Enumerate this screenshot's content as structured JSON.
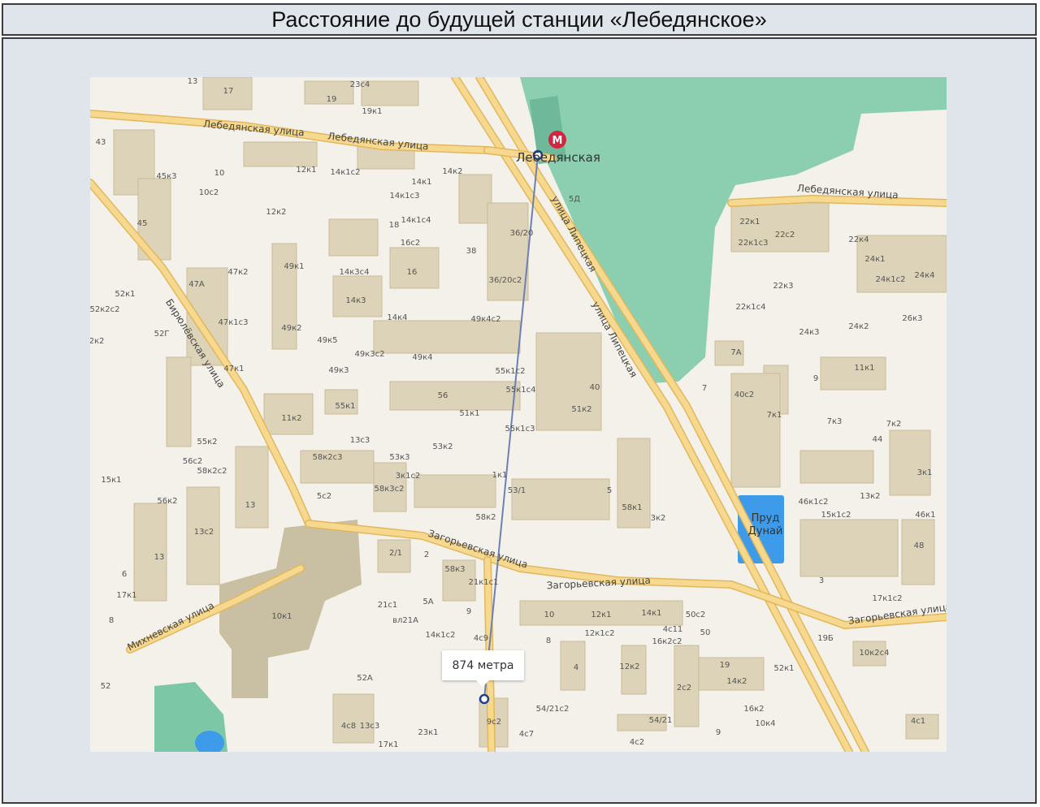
{
  "title": "Расстояние до будущей станции «Лебедянское»",
  "map": {
    "distance_label": "874 метра",
    "metro_station": "Лебедянская",
    "metro_icon": "metro-m-icon",
    "colors": {
      "water": "#8ccfb0",
      "pond": "#3d9be9",
      "road": "#f6d98f",
      "route": "#6d80b3",
      "metro": "#d2253f",
      "building": "#ddd3b8"
    },
    "streets": {
      "lebedyanskaya_1": "Лебедянская улица",
      "lebedyanskaya_2": "Лебедянская улица",
      "lebedyanskaya_3": "Лебедянская улица",
      "lipetskaya_1": "улица Липецкая",
      "lipetskaya_2": "улица Липецкая",
      "birulevskaya": "Бирюлёвская улица",
      "zagoryevskaya_1": "Загорьевская улица",
      "zagoryevskaya_2": "Загорьевская улица",
      "zagoryevskaya_3": "Загорьевская улица",
      "mikhnevskaya": "Михневская улица",
      "pond": "Пруд Дунай"
    },
    "buildings": [
      "13",
      "17",
      "19",
      "23с4",
      "19к1",
      "43",
      "45к3",
      "10",
      "10с2",
      "12к1",
      "14к1с2",
      "14к2",
      "14к1",
      "14к1с3",
      "14к1с4",
      "12к2",
      "45",
      "18",
      "16с2",
      "38",
      "36/20",
      "5Д",
      "47к2",
      "49к1",
      "14к3с4",
      "16",
      "36/20с2",
      "52к1",
      "47А",
      "14к3",
      "14к4",
      "22к1",
      "22к1с3",
      "22с2",
      "22к4",
      "24к1",
      "24к1с2",
      "24к4",
      "22к3",
      "22к1с4",
      "26к3",
      "24к3",
      "24к2",
      "52к2с2",
      "52Г",
      "47к1с3",
      "49к2",
      "49к5",
      "49к4с2",
      "49к3с2",
      "49к4",
      "7А",
      "2к2",
      "47к1",
      "49к3",
      "55к1с2",
      "55к1с4",
      "40",
      "9",
      "11к1",
      "7",
      "56",
      "55к1",
      "51к2",
      "40с2",
      "7к1",
      "7к3",
      "7к2",
      "11к2",
      "51к1",
      "55к1с3",
      "44",
      "13с3",
      "53к2",
      "55к2",
      "56с2",
      "58к2с2",
      "58к2с3",
      "53к3",
      "3к1с2",
      "3к1",
      "15к1",
      "56к2",
      "58к3с2",
      "1к1",
      "5с2",
      "53/1",
      "5",
      "46к1с2",
      "13к2",
      "13",
      "58к1",
      "46к1",
      "15к1с2",
      "13с2",
      "58к2",
      "3к2",
      "48",
      "2/1",
      "2",
      "13",
      "58к3",
      "6",
      "21к1с1",
      "3",
      "17к1",
      "21с1",
      "5А",
      "10",
      "12к1",
      "14к1",
      "50с2",
      "17к1с2",
      "9",
      "10к1",
      "8",
      "вл21А",
      "4с11",
      "14к1с2",
      "50",
      "12к1с2",
      "16к2с2",
      "19Б",
      "4с9",
      "8",
      "10к2с4",
      "19",
      "52к1",
      "52А",
      "4",
      "12к2",
      "14к2",
      "52",
      "2с2",
      "16к2",
      "54/21с2",
      "9с2",
      "10к4",
      "54/21",
      "13с3",
      "4с8",
      "4с1",
      "23к1",
      "4с7",
      "9",
      "17к1",
      "4с2",
      "13"
    ]
  }
}
